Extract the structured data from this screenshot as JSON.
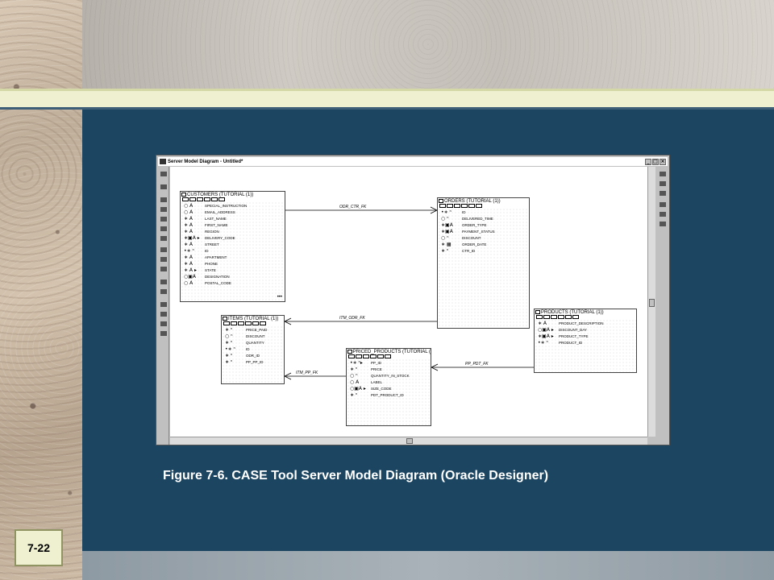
{
  "slide": {
    "caption": "Figure 7-6.  CASE Tool Server Model Diagram (Oracle Designer)",
    "number": "7-22"
  },
  "window": {
    "title": "Server Model Diagram - Untitled*",
    "controls": [
      "_",
      "□",
      "×"
    ]
  },
  "tables": {
    "customers": {
      "title": "CUSTOMERS (TUTORIAL (1))",
      "columns": [
        {
          "flags": "○ A",
          "name": "SPECIAL_INSTRUCTION"
        },
        {
          "flags": "○ A",
          "name": "EMAIL_ADDRESS"
        },
        {
          "flags": "∗ A",
          "name": "LAST_NAME"
        },
        {
          "flags": "∗ A",
          "name": "FIRST_NAME"
        },
        {
          "flags": "∗ A",
          "name": "REGION"
        },
        {
          "flags": "∗▣A ▸",
          "name": "DELIVERY_CODE"
        },
        {
          "flags": "∗ A",
          "name": "STREET"
        },
        {
          "flags": "•∗ ⁿ",
          "name": "ID"
        },
        {
          "flags": "∗ A",
          "name": "APARTMENT"
        },
        {
          "flags": "∗ A",
          "name": "PHONE"
        },
        {
          "flags": "∗ A ▸",
          "name": "STATE"
        },
        {
          "flags": "○▣A",
          "name": "DESIGNATION"
        },
        {
          "flags": "○ A",
          "name": "POSTAL_CODE"
        }
      ],
      "more": "•••"
    },
    "orders": {
      "title": "ORDERS (TUTORIAL (1))",
      "columns": [
        {
          "flags": "•∗ ⁿ",
          "name": "ID"
        },
        {
          "flags": "○ ⁿ",
          "name": "DELIVERED_TIME"
        },
        {
          "flags": "∗▣A",
          "name": "ORDER_TYPE"
        },
        {
          "flags": "∗▣A",
          "name": "PAYMENT_STATUS"
        },
        {
          "flags": "○ ⁿ",
          "name": "DISCOUNT"
        },
        {
          "flags": "∗ ▦",
          "name": "ORDER_DATE"
        },
        {
          "flags": "∗ ⁿ",
          "name": "CTR_ID"
        }
      ]
    },
    "items": {
      "title": "ITEMS (TUTORIAL (1))",
      "columns": [
        {
          "flags": "∗ ⁿ",
          "name": "PRICE_PAID"
        },
        {
          "flags": "○ ⁿ",
          "name": "DISCOUNT"
        },
        {
          "flags": "∗ ⁿ",
          "name": "QUANTITY"
        },
        {
          "flags": "•∗ ⁿ",
          "name": "ID"
        },
        {
          "flags": "∗ ⁿ",
          "name": "ODR_ID"
        },
        {
          "flags": "∗ ⁿ",
          "name": "PP_PP_ID"
        }
      ]
    },
    "priced_products": {
      "title": "PRICED_PRODUCTS (TUTORIAL (",
      "columns": [
        {
          "flags": "•∗ ⁿ▸",
          "name": "PP_ID"
        },
        {
          "flags": "∗ ⁿ",
          "name": "PRICE"
        },
        {
          "flags": "○ ⁿ",
          "name": "QUANTITY_IN_STOCK"
        },
        {
          "flags": "○ A",
          "name": "LABEL"
        },
        {
          "flags": "○▣A ▸",
          "name": "SIZE_CODE"
        },
        {
          "flags": "∗ ⁿ",
          "name": "PDT_PRODUCT_ID"
        }
      ]
    },
    "products": {
      "title": "PRODUCTS (TUTORIAL (1))",
      "columns": [
        {
          "flags": "∗ A",
          "name": "PRODUCT_DESCRIPTION"
        },
        {
          "flags": "○▣A ▸",
          "name": "DISCOUNT_DAY"
        },
        {
          "flags": "∗▣A ▸",
          "name": "PRODUCT_TYPE"
        },
        {
          "flags": "•∗ ⁿ",
          "name": "PRODUCT_ID"
        }
      ]
    }
  },
  "foreign_keys": {
    "odr_ctr": "ODR_CTR_FK",
    "itm_odr": "ITM_ODR_FK",
    "itm_pp": "ITM_PP_FK",
    "pp_pdt": "PP_PDT_FK"
  }
}
